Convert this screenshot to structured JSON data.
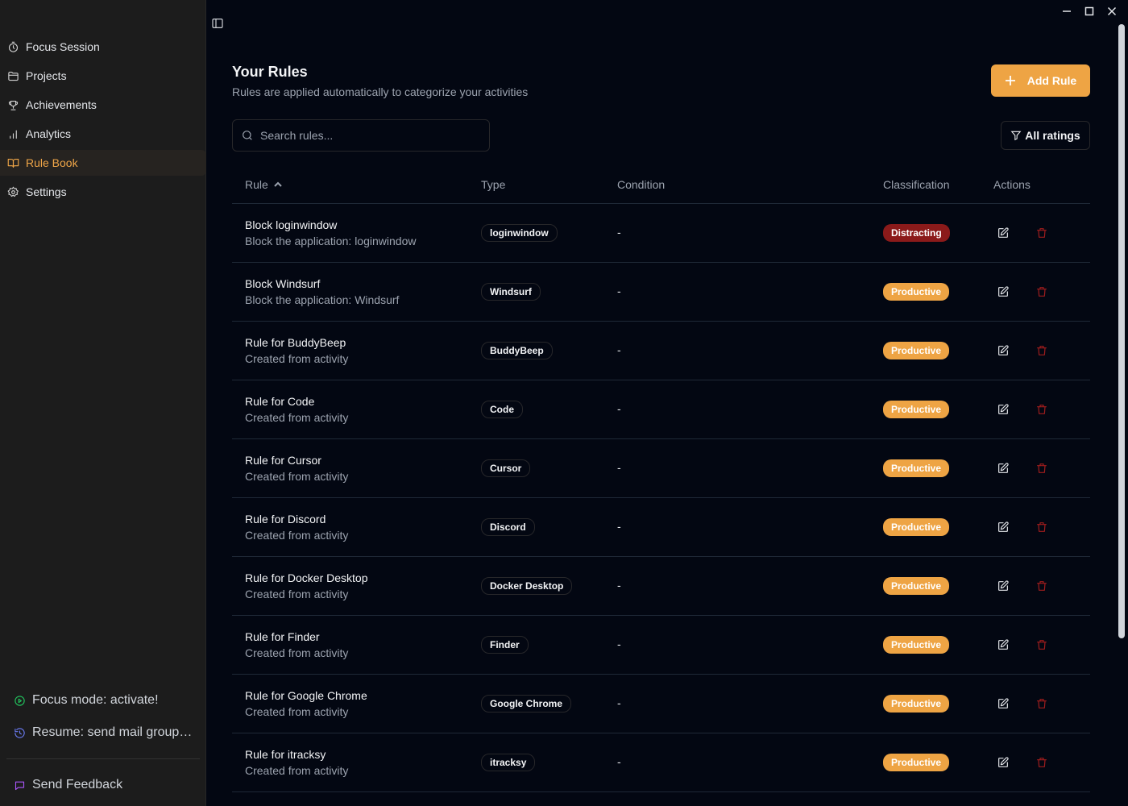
{
  "sidebar": {
    "items": [
      {
        "label": "Focus Session",
        "icon": "timer-icon"
      },
      {
        "label": "Projects",
        "icon": "folder-icon"
      },
      {
        "label": "Achievements",
        "icon": "trophy-icon"
      },
      {
        "label": "Analytics",
        "icon": "bar-chart-icon"
      },
      {
        "label": "Rule Book",
        "icon": "book-open-icon",
        "active": true
      },
      {
        "label": "Settings",
        "icon": "gear-icon"
      }
    ],
    "quick": {
      "focus_mode": "Focus mode: activate!",
      "resume": "Resume: send mail group chats"
    },
    "feedback": "Send Feedback"
  },
  "header": {
    "title": "Your Rules",
    "subtitle": "Rules are applied automatically to categorize your activities",
    "add_button": "Add Rule"
  },
  "search": {
    "placeholder": "Search rules..."
  },
  "filter": {
    "label": "All ratings"
  },
  "table": {
    "columns": [
      "Rule",
      "Type",
      "Condition",
      "Classification",
      "Actions"
    ],
    "rows": [
      {
        "name": "Block loginwindow",
        "desc": "Block the application: loginwindow",
        "type": "loginwindow",
        "condition": "-",
        "classification": "Distracting"
      },
      {
        "name": "Block Windsurf",
        "desc": "Block the application: Windsurf",
        "type": "Windsurf",
        "condition": "-",
        "classification": "Productive"
      },
      {
        "name": "Rule for BuddyBeep",
        "desc": "Created from activity",
        "type": "BuddyBeep",
        "condition": "-",
        "classification": "Productive"
      },
      {
        "name": "Rule for Code",
        "desc": "Created from activity",
        "type": "Code",
        "condition": "-",
        "classification": "Productive"
      },
      {
        "name": "Rule for Cursor",
        "desc": "Created from activity",
        "type": "Cursor",
        "condition": "-",
        "classification": "Productive"
      },
      {
        "name": "Rule for Discord",
        "desc": "Created from activity",
        "type": "Discord",
        "condition": "-",
        "classification": "Productive"
      },
      {
        "name": "Rule for Docker Desktop",
        "desc": "Created from activity",
        "type": "Docker Desktop",
        "condition": "-",
        "classification": "Productive"
      },
      {
        "name": "Rule for Finder",
        "desc": "Created from activity",
        "type": "Finder",
        "condition": "-",
        "classification": "Productive"
      },
      {
        "name": "Rule for Google Chrome",
        "desc": "Created from activity",
        "type": "Google Chrome",
        "condition": "-",
        "classification": "Productive"
      },
      {
        "name": "Rule for itracksy",
        "desc": "Created from activity",
        "type": "itracksy",
        "condition": "-",
        "classification": "Productive"
      }
    ]
  },
  "colors": {
    "accent": "#eea444",
    "productive": "#eea444",
    "distracting": "#8b1a1a",
    "background": "#030712",
    "sidebar": "#1c1c1c",
    "focus_icon": "#22c55e",
    "resume_icon": "#6b7cf5",
    "feedback_icon": "#a855f7",
    "delete_icon": "#9f1d1d"
  }
}
